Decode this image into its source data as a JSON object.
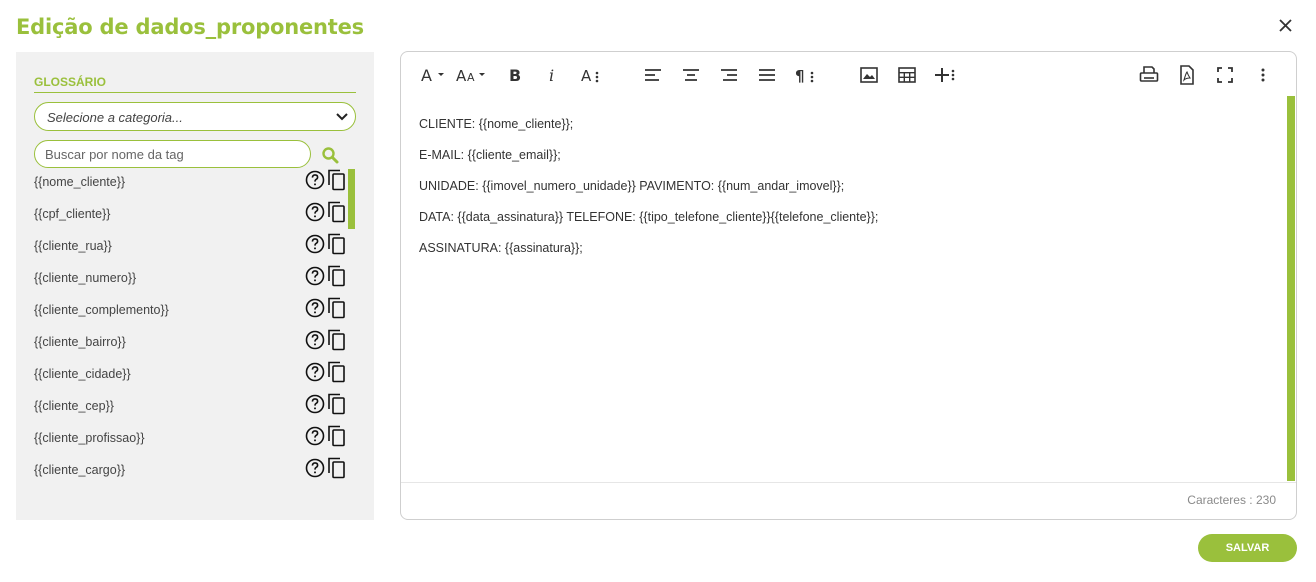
{
  "dialog": {
    "title": "Edição de dados_proponentes"
  },
  "glossary": {
    "title": "GLOSSÁRIO",
    "category_placeholder": "Selecione a categoria...",
    "search_placeholder": "Buscar por nome da tag",
    "tags": [
      "{{nome_cliente}}",
      "{{cpf_cliente}}",
      "{{cliente_rua}}",
      "{{cliente_numero}}",
      "{{cliente_complemento}}",
      "{{cliente_bairro}}",
      "{{cliente_cidade}}",
      "{{cliente_cep}}",
      "{{cliente_profissao}}",
      "{{cliente_cargo}}"
    ]
  },
  "editor": {
    "lines": [
      "CLIENTE: {{nome_cliente}};",
      "E-MAIL: {{cliente_email}};",
      "UNIDADE: {{imovel_numero_unidade}}  PAVIMENTO: {{num_andar_imovel}};",
      "DATA: {{data_assinatura}}  TELEFONE: {{tipo_telefone_cliente}}{{telefone_cliente}};",
      "ASSINATURA: {{assinatura}};"
    ],
    "char_count": "Caracteres : 230"
  },
  "actions": {
    "save_label": "SALVAR"
  },
  "colors": {
    "accent": "#9ac03c"
  }
}
